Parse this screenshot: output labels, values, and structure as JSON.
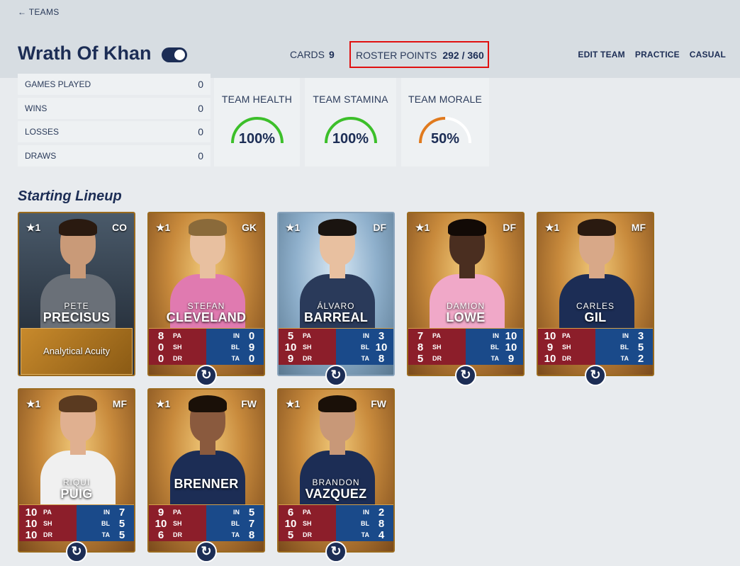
{
  "header": {
    "back_label": "← TEAMS",
    "team_name": "Wrath Of Khan",
    "cards_label": "CARDS",
    "cards_value": "9",
    "roster_label": "ROSTER POINTS",
    "roster_value": "292 / 360",
    "nav": [
      "EDIT TEAM",
      "PRACTICE",
      "CASUAL"
    ]
  },
  "record": [
    {
      "label": "GAMES PLAYED",
      "value": "0"
    },
    {
      "label": "WINS",
      "value": "0"
    },
    {
      "label": "LOSSES",
      "value": "0"
    },
    {
      "label": "DRAWS",
      "value": "0"
    }
  ],
  "gauges": [
    {
      "title": "TEAM HEALTH",
      "value": "100%",
      "fraction": 1.0,
      "color": "#3cbf2a"
    },
    {
      "title": "TEAM STAMINA",
      "value": "100%",
      "fraction": 1.0,
      "color": "#3cbf2a"
    },
    {
      "title": "TEAM MORALE",
      "value": "50%",
      "fraction": 0.5,
      "color": "#e07a1e"
    }
  ],
  "section_title": "Starting Lineup",
  "cards": [
    {
      "star": "★1",
      "pos": "CO",
      "first": "PETE",
      "last": "PRECISUS",
      "ability": "Analytical Acuity",
      "style": "coach",
      "skin": "#c99a78",
      "hair": "#2a1a10",
      "shirt": "#6a7078"
    },
    {
      "star": "★1",
      "pos": "GK",
      "first": "STEFAN",
      "last": "CLEVELAND",
      "style": "gold",
      "skin": "#e8c0a0",
      "hair": "#8a6a3a",
      "shirt": "#e07ab0",
      "stats": [
        [
          "8",
          "PA",
          "IN",
          "0"
        ],
        [
          "0",
          "SH",
          "BL",
          "9"
        ],
        [
          "0",
          "DR",
          "TA",
          "0"
        ]
      ]
    },
    {
      "star": "★1",
      "pos": "DF",
      "first": "ÁLVARO",
      "last": "BARREAL",
      "style": "blue",
      "skin": "#e8c0a0",
      "hair": "#1a1410",
      "shirt": "#2a3a5a",
      "stats": [
        [
          "5",
          "PA",
          "IN",
          "3"
        ],
        [
          "10",
          "SH",
          "BL",
          "10"
        ],
        [
          "9",
          "DR",
          "TA",
          "8"
        ]
      ]
    },
    {
      "star": "★1",
      "pos": "DF",
      "first": "DAMION",
      "last": "LOWE",
      "style": "gold",
      "skin": "#4a2e20",
      "hair": "#120a06",
      "shirt": "#f0a8c8",
      "stats": [
        [
          "7",
          "PA",
          "IN",
          "10"
        ],
        [
          "8",
          "SH",
          "BL",
          "10"
        ],
        [
          "5",
          "DR",
          "TA",
          "9"
        ]
      ]
    },
    {
      "star": "★1",
      "pos": "MF",
      "first": "CARLES",
      "last": "GIL",
      "style": "gold",
      "skin": "#d8a888",
      "hair": "#2a1a10",
      "shirt": "#1c2d55",
      "stats": [
        [
          "10",
          "PA",
          "IN",
          "3"
        ],
        [
          "9",
          "SH",
          "BL",
          "5"
        ],
        [
          "10",
          "DR",
          "TA",
          "2"
        ]
      ]
    },
    {
      "star": "★1",
      "pos": "MF",
      "first": "RIQUI",
      "last": "PUIG",
      "style": "gold",
      "skin": "#e0b090",
      "hair": "#5a3a20",
      "shirt": "#f0f0f0",
      "stats": [
        [
          "10",
          "PA",
          "IN",
          "7"
        ],
        [
          "10",
          "SH",
          "BL",
          "5"
        ],
        [
          "10",
          "DR",
          "TA",
          "5"
        ]
      ]
    },
    {
      "star": "★1",
      "pos": "FW",
      "first": "",
      "last": "BRENNER",
      "style": "gold",
      "skin": "#8a5a3e",
      "hair": "#1a1008",
      "shirt": "#1c2d55",
      "stats": [
        [
          "9",
          "PA",
          "IN",
          "5"
        ],
        [
          "10",
          "SH",
          "BL",
          "7"
        ],
        [
          "6",
          "DR",
          "TA",
          "8"
        ]
      ]
    },
    {
      "star": "★1",
      "pos": "FW",
      "first": "BRANDON",
      "last": "VAZQUEZ",
      "style": "gold",
      "skin": "#c89878",
      "hair": "#1a1008",
      "shirt": "#1c2d55",
      "stats": [
        [
          "6",
          "PA",
          "IN",
          "2"
        ],
        [
          "10",
          "SH",
          "BL",
          "8"
        ],
        [
          "5",
          "DR",
          "TA",
          "4"
        ]
      ]
    }
  ],
  "swap_icon": "↻"
}
